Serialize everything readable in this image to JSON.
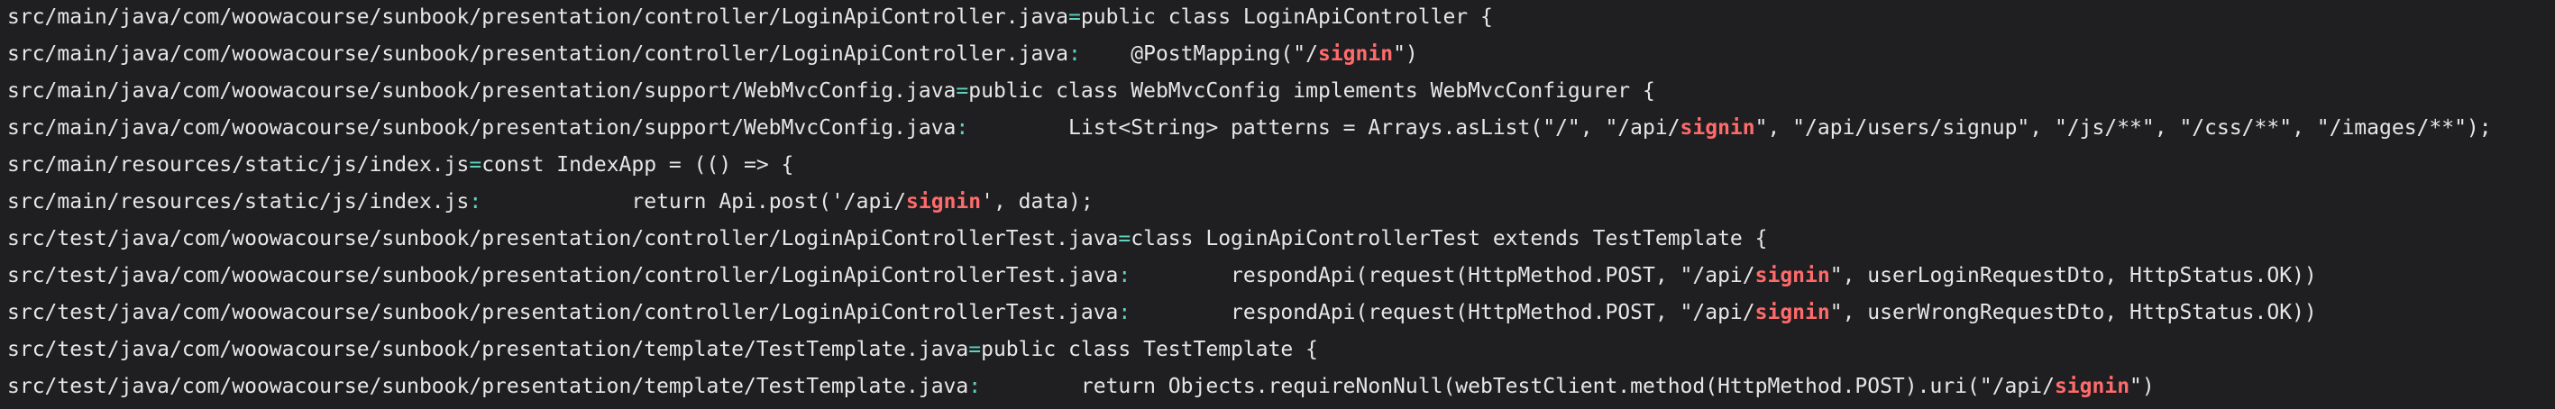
{
  "theme": {
    "background": "#1f1f22",
    "text": "#e6e6e6",
    "separator": "#5fd3bc",
    "match": "#ff6b6b"
  },
  "lines": [
    {
      "path": "src/main/java/com/woowacourse/sunbook/presentation/controller/LoginApiController.java",
      "sep": "=",
      "pre": "public class LoginApiController {",
      "match": "",
      "post": ""
    },
    {
      "path": "src/main/java/com/woowacourse/sunbook/presentation/controller/LoginApiController.java",
      "sep": ":",
      "pre": "    @PostMapping(\"/",
      "match": "signin",
      "post": "\")"
    },
    {
      "path": "src/main/java/com/woowacourse/sunbook/presentation/support/WebMvcConfig.java",
      "sep": "=",
      "pre": "public class WebMvcConfig implements WebMvcConfigurer {",
      "match": "",
      "post": ""
    },
    {
      "path": "src/main/java/com/woowacourse/sunbook/presentation/support/WebMvcConfig.java",
      "sep": ":",
      "pre": "        List<String> patterns = Arrays.asList(\"/\", \"/api/",
      "match": "signin",
      "post": "\", \"/api/users/signup\", \"/js/**\", \"/css/**\", \"/images/**\");"
    },
    {
      "path": "src/main/resources/static/js/index.js",
      "sep": "=",
      "pre": "const IndexApp = (() => {",
      "match": "",
      "post": ""
    },
    {
      "path": "src/main/resources/static/js/index.js",
      "sep": ":",
      "pre": "            return Api.post('/api/",
      "match": "signin",
      "post": "', data);"
    },
    {
      "path": "src/test/java/com/woowacourse/sunbook/presentation/controller/LoginApiControllerTest.java",
      "sep": "=",
      "pre": "class LoginApiControllerTest extends TestTemplate {",
      "match": "",
      "post": ""
    },
    {
      "path": "src/test/java/com/woowacourse/sunbook/presentation/controller/LoginApiControllerTest.java",
      "sep": ":",
      "pre": "        respondApi(request(HttpMethod.POST, \"/api/",
      "match": "signin",
      "post": "\", userLoginRequestDto, HttpStatus.OK))"
    },
    {
      "path": "src/test/java/com/woowacourse/sunbook/presentation/controller/LoginApiControllerTest.java",
      "sep": ":",
      "pre": "        respondApi(request(HttpMethod.POST, \"/api/",
      "match": "signin",
      "post": "\", userWrongRequestDto, HttpStatus.OK))"
    },
    {
      "path": "src/test/java/com/woowacourse/sunbook/presentation/template/TestTemplate.java",
      "sep": "=",
      "pre": "public class TestTemplate {",
      "match": "",
      "post": ""
    },
    {
      "path": "src/test/java/com/woowacourse/sunbook/presentation/template/TestTemplate.java",
      "sep": ":",
      "pre": "        return Objects.requireNonNull(webTestClient.method(HttpMethod.POST).uri(\"/api/",
      "match": "signin",
      "post": "\")"
    }
  ]
}
